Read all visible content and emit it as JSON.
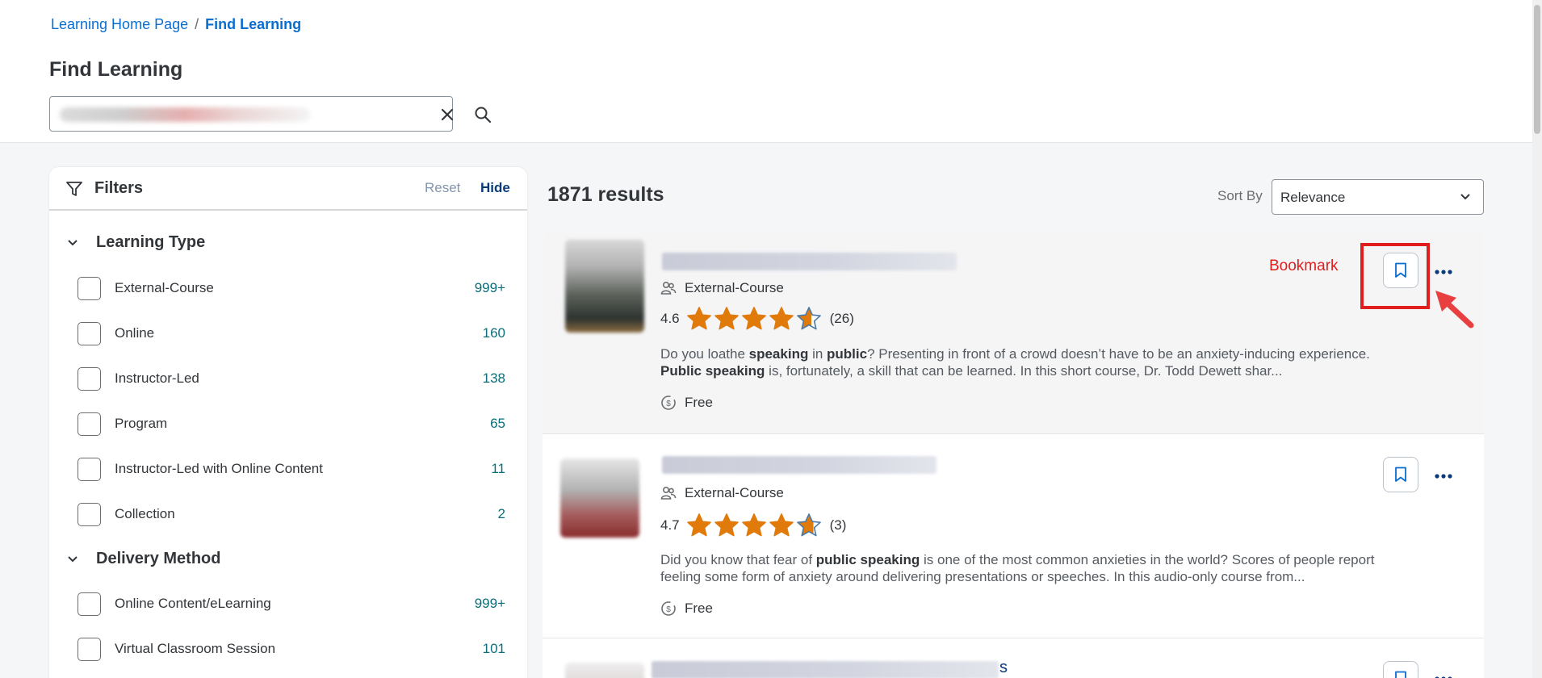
{
  "breadcrumb": {
    "home": "Learning Home Page",
    "separator": "/",
    "current": "Find Learning"
  },
  "page": {
    "title": "Find Learning"
  },
  "search": {
    "value": "",
    "placeholder": "",
    "clear_icon": "close-icon",
    "search_icon": "search-icon"
  },
  "filters": {
    "title": "Filters",
    "reset": "Reset",
    "hide": "Hide",
    "groups": [
      {
        "title": "Learning Type",
        "items": [
          {
            "label": "External-Course",
            "count": "999+"
          },
          {
            "label": "Online",
            "count": "160"
          },
          {
            "label": "Instructor-Led",
            "count": "138"
          },
          {
            "label": "Program",
            "count": "65"
          },
          {
            "label": "Instructor-Led with Online Content",
            "count": "11"
          },
          {
            "label": "Collection",
            "count": "2"
          }
        ]
      },
      {
        "title": "Delivery Method",
        "items": [
          {
            "label": "Online Content/eLearning",
            "count": "999+"
          },
          {
            "label": "Virtual Classroom Session",
            "count": "101"
          }
        ]
      }
    ]
  },
  "results": {
    "count": "1871 results",
    "sort_label": "Sort By",
    "sort_value": "Relevance",
    "items": [
      {
        "type": "External-Course",
        "rating": "4.6",
        "rating_value": 4.6,
        "reviews": "(26)",
        "price": "Free"
      },
      {
        "type": "External-Course",
        "rating": "4.7",
        "rating_value": 4.7,
        "reviews": "(3)",
        "price": "Free"
      },
      {
        "title_tail": "s"
      }
    ]
  },
  "annotation": {
    "label": "Bookmark",
    "color": "#e01e1e"
  },
  "colors": {
    "link": "#0a6ed1",
    "star": "#e07a0a",
    "accent_dark": "#0a3a7a"
  }
}
